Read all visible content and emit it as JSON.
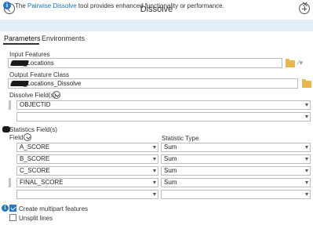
{
  "window": {
    "title": "Dissolve"
  },
  "info_bar": {
    "prefix": "The ",
    "link": "Pairwise Dissolve",
    "suffix": " tool provides enhanced functionality or performance.",
    "close": "✕"
  },
  "tabs": [
    {
      "label": "Parameters",
      "active": true
    },
    {
      "label": "Environments",
      "active": false
    }
  ],
  "input_features": {
    "label": "Input Features",
    "value": "_Locations"
  },
  "output_feature_class": {
    "label": "Output Feature Class",
    "value": "_Locations_Dissolve"
  },
  "dissolve_fields": {
    "label": "Dissolve Field(s)",
    "rows": [
      "OBJECTID",
      ""
    ]
  },
  "statistics_fields": {
    "label": "Statistics Field(s)",
    "col_field": "Field",
    "col_type": "Statistic Type",
    "rows": [
      {
        "field": "A_SCORE",
        "type": "Sum"
      },
      {
        "field": "B_SCORE",
        "type": "Sum"
      },
      {
        "field": "C_SCORE",
        "type": "Sum"
      },
      {
        "field": "FINAL_SCORE",
        "type": "Sum"
      },
      {
        "field": "",
        "type": ""
      }
    ]
  },
  "options": {
    "multipart": {
      "label": "Create multipart features",
      "checked": true
    },
    "unsplit": {
      "label": "Unsplit lines",
      "checked": false
    }
  }
}
